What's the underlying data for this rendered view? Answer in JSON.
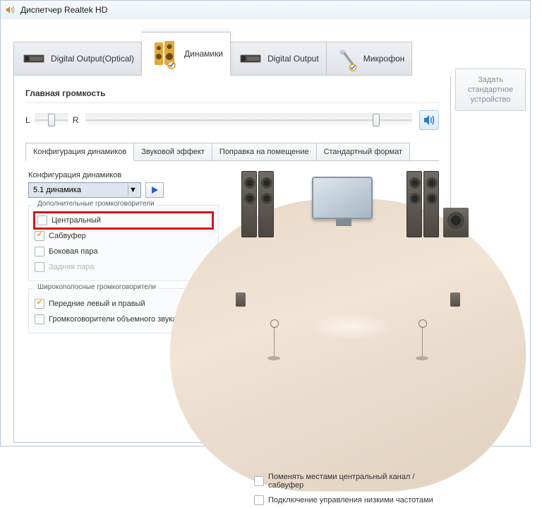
{
  "window": {
    "title": "Диспетчер Realtek HD"
  },
  "tabs": [
    {
      "label": "Digital Output(Optical)"
    },
    {
      "label": "Динамики"
    },
    {
      "label": "Digital Output"
    },
    {
      "label": "Микрофон"
    }
  ],
  "volume": {
    "title": "Главная громкость",
    "left_label": "L",
    "right_label": "R"
  },
  "side_button": "Задать стандартное устройство",
  "subtabs": [
    "Конфигурация динамиков",
    "Звуковой эффект",
    "Поправка на помещение",
    "Стандартный формат"
  ],
  "config": {
    "label": "Конфигурация динамиков",
    "selected": "5.1 динамика"
  },
  "groups": {
    "extra": {
      "title": "Дополнительные громкоговорители",
      "items": [
        {
          "label": "Центральный",
          "checked": false,
          "highlight": true
        },
        {
          "label": "Сабвуфер",
          "checked": true
        },
        {
          "label": "Боковая пара",
          "checked": false
        },
        {
          "label": "Задняя пара",
          "checked": false,
          "disabled": true
        }
      ]
    },
    "fullrange": {
      "title": "Широкополосные громкоговорители",
      "items": [
        {
          "label": "Передние левый и правый",
          "checked": true
        },
        {
          "label": "Громкоговорители объемного звука",
          "checked": false
        }
      ]
    }
  },
  "bottom": [
    {
      "label": "Поменять местами центральный канал / сабвуфер",
      "checked": false
    },
    {
      "label": "Подключение управления низкими частотами",
      "checked": false
    }
  ]
}
